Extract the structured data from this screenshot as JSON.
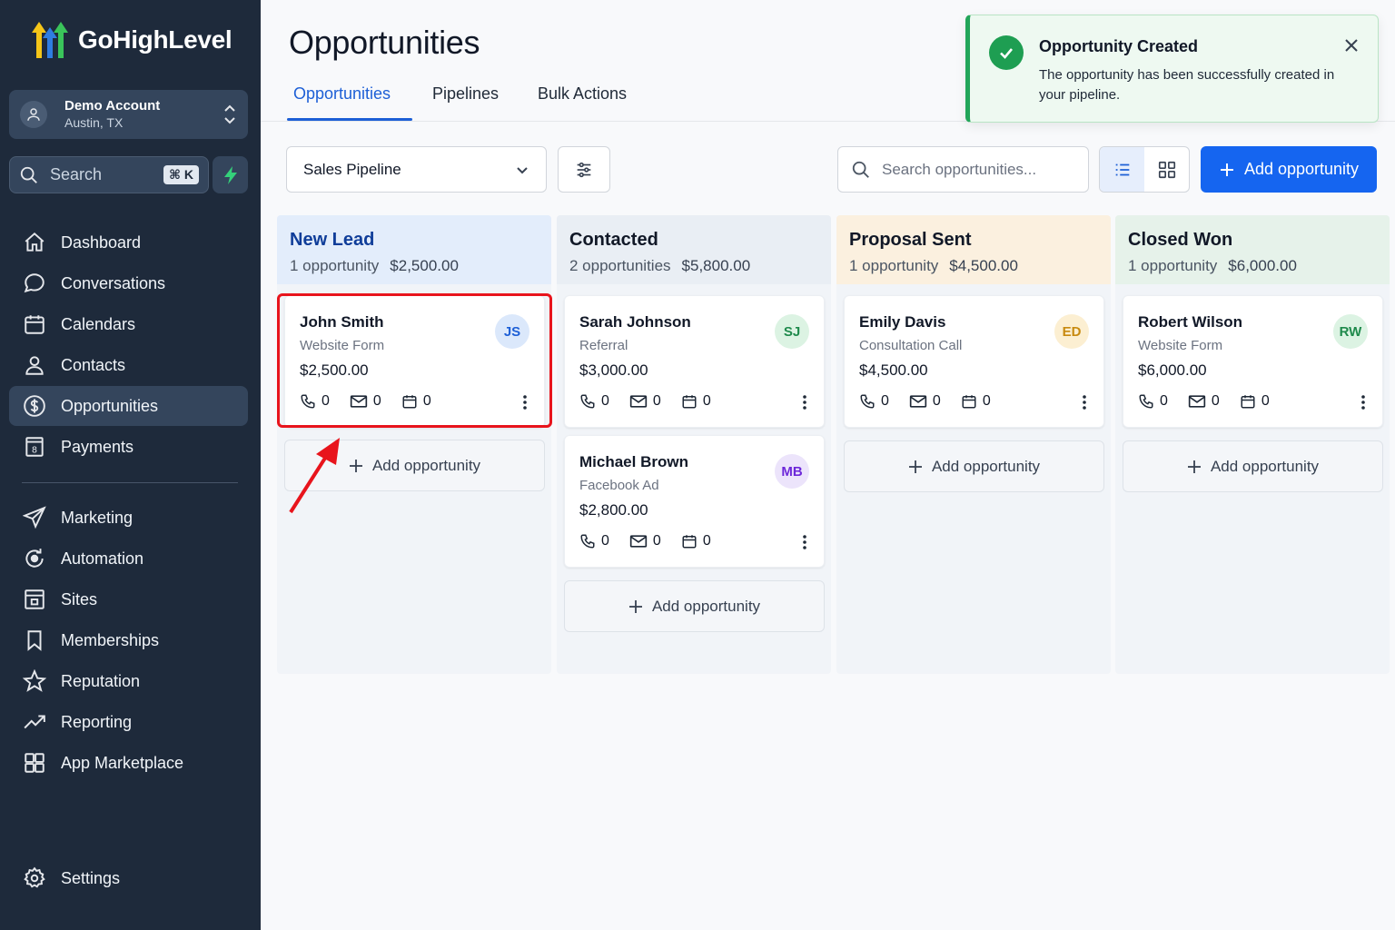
{
  "brand": {
    "name": "GoHighLevel"
  },
  "account": {
    "name": "Demo Account",
    "location": "Austin, TX"
  },
  "sidebar_search": {
    "label": "Search",
    "shortcut": "⌘ K"
  },
  "nav": {
    "primary": [
      {
        "label": "Dashboard",
        "icon": "home-icon"
      },
      {
        "label": "Conversations",
        "icon": "chat-icon"
      },
      {
        "label": "Calendars",
        "icon": "calendar-icon"
      },
      {
        "label": "Contacts",
        "icon": "person-icon"
      },
      {
        "label": "Opportunities",
        "icon": "dollar-icon",
        "active": true
      },
      {
        "label": "Payments",
        "icon": "receipt-icon"
      }
    ],
    "secondary": [
      {
        "label": "Marketing",
        "icon": "send-icon"
      },
      {
        "label": "Automation",
        "icon": "automation-icon"
      },
      {
        "label": "Sites",
        "icon": "sites-icon"
      },
      {
        "label": "Memberships",
        "icon": "bookmark-icon"
      },
      {
        "label": "Reputation",
        "icon": "star-icon"
      },
      {
        "label": "Reporting",
        "icon": "trend-icon"
      },
      {
        "label": "App Marketplace",
        "icon": "grid-icon"
      }
    ],
    "settings": {
      "label": "Settings",
      "icon": "gear-icon"
    }
  },
  "page": {
    "title": "Opportunities",
    "tabs": [
      {
        "label": "Opportunities",
        "active": true
      },
      {
        "label": "Pipelines"
      },
      {
        "label": "Bulk Actions"
      }
    ]
  },
  "toolbar": {
    "pipeline": "Sales Pipeline",
    "search_placeholder": "Search opportunities...",
    "add_label": "Add opportunity",
    "view": "list"
  },
  "columns": [
    {
      "title": "New Lead",
      "count_label": "1 opportunity",
      "total": "$2,500.00",
      "header_color": "#e3edfb",
      "title_color": "#0f3d99",
      "cards": [
        {
          "name": "John Smith",
          "source": "Website Form",
          "value": "$2,500.00",
          "initials": "JS",
          "avatar_bg": "#dbe8fb",
          "avatar_fg": "#1d5fd6",
          "calls": "0",
          "emails": "0",
          "events": "0"
        }
      ],
      "add_label": "Add opportunity"
    },
    {
      "title": "Contacted",
      "count_label": "2 opportunities",
      "total": "$5,800.00",
      "header_color": "#e9eef4",
      "title_color": "#111827",
      "cards": [
        {
          "name": "Sarah Johnson",
          "source": "Referral",
          "value": "$3,000.00",
          "initials": "SJ",
          "avatar_bg": "#dcf3e3",
          "avatar_fg": "#1f8a4c",
          "calls": "0",
          "emails": "0",
          "events": "0"
        },
        {
          "name": "Michael Brown",
          "source": "Facebook Ad",
          "value": "$2,800.00",
          "initials": "MB",
          "avatar_bg": "#ece4fb",
          "avatar_fg": "#6d28d9",
          "calls": "0",
          "emails": "0",
          "events": "0"
        }
      ],
      "add_label": "Add opportunity"
    },
    {
      "title": "Proposal Sent",
      "count_label": "1 opportunity",
      "total": "$4,500.00",
      "header_color": "#fbf0df",
      "title_color": "#111827",
      "cards": [
        {
          "name": "Emily Davis",
          "source": "Consultation Call",
          "value": "$4,500.00",
          "initials": "ED",
          "avatar_bg": "#fcefd2",
          "avatar_fg": "#c88a10",
          "calls": "0",
          "emails": "0",
          "events": "0"
        }
      ],
      "add_label": "Add opportunity"
    },
    {
      "title": "Closed Won",
      "count_label": "1 opportunity",
      "total": "$6,000.00",
      "header_color": "#e6f2ea",
      "title_color": "#111827",
      "cards": [
        {
          "name": "Robert Wilson",
          "source": "Website Form",
          "value": "$6,000.00",
          "initials": "RW",
          "avatar_bg": "#dcf3e3",
          "avatar_fg": "#1f8a4c",
          "calls": "0",
          "emails": "0",
          "events": "0"
        }
      ],
      "add_label": "Add opportunity"
    }
  ],
  "toast": {
    "title": "Opportunity Created",
    "message": "The opportunity has been successfully created in your pipeline."
  },
  "colors": {
    "accent": "#1565f0",
    "sidebar": "#1e2a3b",
    "success": "#1e9e52",
    "highlight": "#e8141c"
  }
}
